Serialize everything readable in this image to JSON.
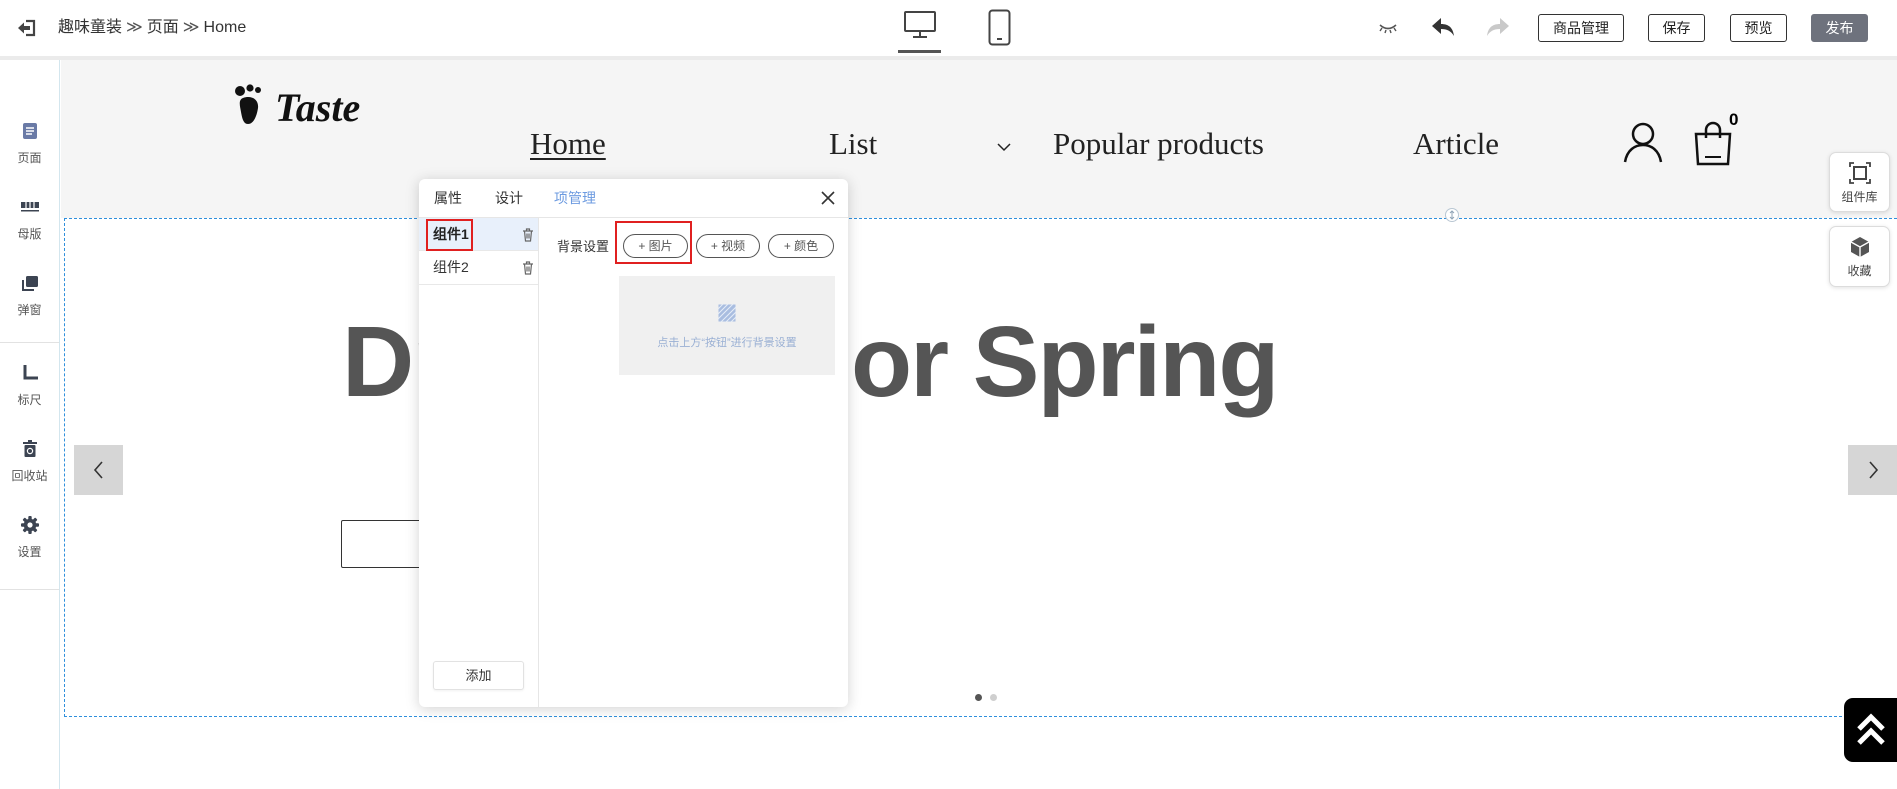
{
  "topbar": {
    "breadcrumb": [
      "趣味童装",
      "页面",
      "Home"
    ],
    "breadcrumb_separator": "≫",
    "desktop_active": true,
    "buttons": {
      "products": "商品管理",
      "save": "保存",
      "preview": "预览",
      "publish": "发布"
    },
    "icons": [
      "exit-icon",
      "desktop-icon",
      "mobile-icon",
      "eye-closed-icon",
      "undo-icon",
      "redo-icon"
    ]
  },
  "sidebar": {
    "items": [
      {
        "label": "页面",
        "icon": "page-icon"
      },
      {
        "label": "母版",
        "icon": "master-template-icon"
      },
      {
        "label": "弹窗",
        "icon": "popup-icon"
      },
      {
        "label": "标尺",
        "icon": "ruler-icon"
      },
      {
        "label": "回收站",
        "icon": "recycle-bin-icon"
      },
      {
        "label": "设置",
        "icon": "gear-icon"
      }
    ]
  },
  "site": {
    "logo_text": "Taste",
    "nav": [
      {
        "label": "Home",
        "active": true
      },
      {
        "label": "List",
        "has_dropdown": true
      },
      {
        "label": "Popular products"
      },
      {
        "label": "Article"
      }
    ],
    "cart_count": "0"
  },
  "hero": {
    "title_visible_left": "Dr",
    "title_visible_right": "or Spring",
    "slide_count": 2,
    "active_slide": 0
  },
  "right_panel": {
    "components": "组件库",
    "favorites": "收藏"
  },
  "dialog": {
    "tabs": [
      "属性",
      "设计",
      "项管理"
    ],
    "active_tab": 2,
    "items": [
      "组件1",
      "组件2"
    ],
    "selected_item": 0,
    "add_label": "添加",
    "background": {
      "label": "背景设置",
      "buttons": [
        "+ 图片",
        "+ 视频",
        "+ 颜色"
      ],
      "hint": "点击上方“按钮”进行背景设置"
    }
  },
  "colors": {
    "accent": "#6d9be0",
    "publish": "#6e727d",
    "selection_dashed": "#2f8fdc",
    "highlight_box": "#e02020",
    "hero_text": "#555555"
  }
}
